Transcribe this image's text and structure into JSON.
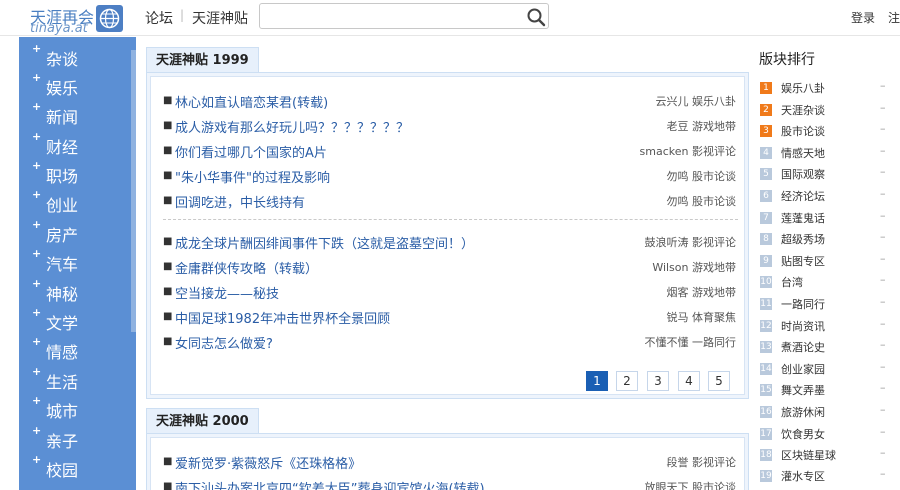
{
  "header": {
    "logo_line1": "天涯再会",
    "logo_line2": "tinaya.at",
    "nav_forum": "论坛",
    "nav_sep": "|",
    "nav_tianya": "天涯神贴",
    "search_placeholder": "",
    "login": "登录",
    "register": "注"
  },
  "sidebar": {
    "items": [
      "杂谈",
      "娱乐",
      "新闻",
      "财经",
      "职场",
      "创业",
      "房产",
      "汽车",
      "神秘",
      "文学",
      "情感",
      "生活",
      "城市",
      "亲子",
      "校园"
    ]
  },
  "panels": [
    {
      "title": "天涯神贴 1999",
      "groups": [
        [
          {
            "title": "林心如直认暗恋某君(转载)",
            "meta": "云兴儿 娱乐八卦"
          },
          {
            "title": "成人游戏有那么好玩儿吗？？？？？？？",
            "meta": "老豆 游戏地带"
          },
          {
            "title": "你们看过哪几个国家的A片",
            "meta": "smacken 影视评论"
          },
          {
            "title": "\"朱小华事件\"的过程及影响",
            "meta": "勿鸣 股市论谈"
          },
          {
            "title": "回调吃进，中长线持有",
            "meta": "勿鸣 股市论谈"
          }
        ],
        [
          {
            "title": "成龙全球片酬因绯闻事件下跌（这就是盗墓空间！）",
            "meta": "鼓浪听涛 影视评论"
          },
          {
            "title": "金庸群侠传攻略（转载）",
            "meta": "Wilson 游戏地带"
          },
          {
            "title": "空当接龙——秘技",
            "meta": "烟客 游戏地带"
          },
          {
            "title": "中国足球1982年冲击世界杯全景回顾",
            "meta": "锐马 体育聚焦"
          },
          {
            "title": "女同志怎么做爱?",
            "meta": "不懂不懂 一路同行"
          }
        ]
      ],
      "pages": [
        "1",
        "2",
        "3",
        "4",
        "5"
      ],
      "active_page": "1"
    },
    {
      "title": "天涯神贴 2000",
      "groups": [
        [
          {
            "title": "爱新觉罗·紫薇怒斥《还珠格格》",
            "meta": "段誉 影视评论"
          },
          {
            "title": "南下汕头办案北京四“钦差大臣”葬身迎宾馆火海(转载)",
            "meta": "放眼天下 股市论谈"
          }
        ]
      ]
    }
  ],
  "rank": {
    "title": "版块排行",
    "items": [
      {
        "num": "1",
        "name": "娱乐八卦",
        "trend": "–"
      },
      {
        "num": "2",
        "name": "天涯杂谈",
        "trend": "–"
      },
      {
        "num": "3",
        "name": "股市论谈",
        "trend": "–"
      },
      {
        "num": "4",
        "name": "情感天地",
        "trend": "–"
      },
      {
        "num": "5",
        "name": "国际观察",
        "trend": "–"
      },
      {
        "num": "6",
        "name": "经济论坛",
        "trend": "–"
      },
      {
        "num": "7",
        "name": "莲蓬鬼话",
        "trend": "–"
      },
      {
        "num": "8",
        "name": "超级秀场",
        "trend": "–"
      },
      {
        "num": "9",
        "name": "贴图专区",
        "trend": "–"
      },
      {
        "num": "10",
        "name": "台湾",
        "trend": "–"
      },
      {
        "num": "11",
        "name": "一路同行",
        "trend": "–"
      },
      {
        "num": "12",
        "name": "时尚资讯",
        "trend": "–"
      },
      {
        "num": "13",
        "name": "煮酒论史",
        "trend": "–"
      },
      {
        "num": "14",
        "name": "创业家园",
        "trend": "–"
      },
      {
        "num": "15",
        "name": "舞文弄墨",
        "trend": "–"
      },
      {
        "num": "16",
        "name": "旅游休闲",
        "trend": "–"
      },
      {
        "num": "17",
        "name": "饮食男女",
        "trend": "–"
      },
      {
        "num": "18",
        "name": "区块链星球",
        "trend": "–"
      },
      {
        "num": "19",
        "name": "灌水专区",
        "trend": "–"
      }
    ]
  },
  "colors": {
    "accent": "#5b8fd4",
    "link": "#2a5da6",
    "hot_rank": "#f07a1a",
    "active_page": "#1a5fb4"
  }
}
